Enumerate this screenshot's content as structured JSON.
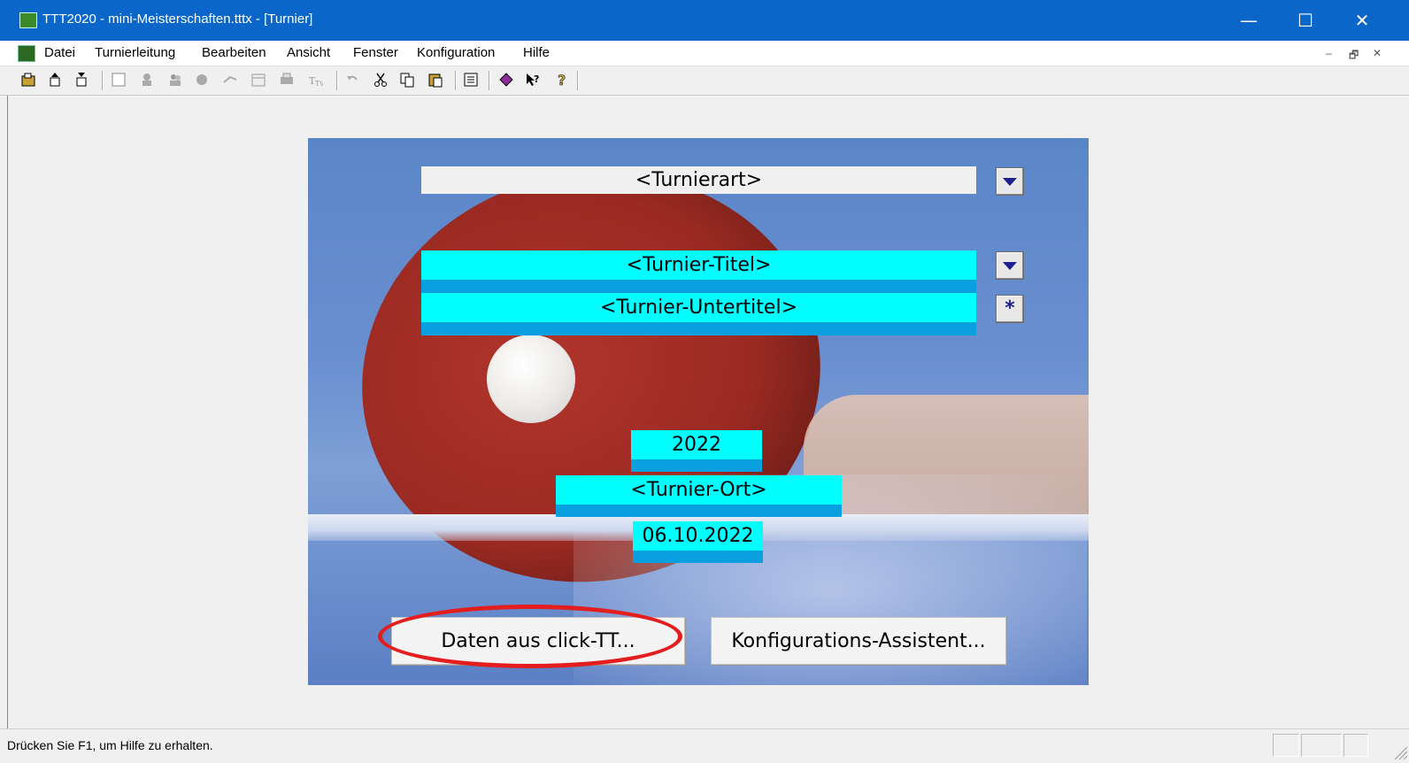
{
  "window": {
    "title": "TTT2020 - mini-Meisterschaften.tttx - [Turnier]",
    "controls": {
      "minimize": "—",
      "maximize": "☐",
      "close": "✕"
    }
  },
  "menu": {
    "items": [
      "Datei",
      "Turnierleitung",
      "Bearbeiten",
      "Ansicht",
      "Fenster",
      "Konfiguration",
      "Hilfe"
    ],
    "mdi_controls": {
      "minimize": "–",
      "restore": "🗗",
      "close": "✕"
    }
  },
  "toolbar": {
    "icons": [
      "open-icon",
      "export-icon",
      "import-icon",
      "window-icon",
      "person-icon",
      "group-icon",
      "table-icon",
      "run-icon",
      "calendar-icon",
      "print-icon",
      "tt-icon",
      "undo-icon",
      "cut-icon",
      "copy-icon",
      "paste-icon",
      "list-icon",
      "book-icon",
      "context-help-icon",
      "help-icon"
    ]
  },
  "form": {
    "turnierart": "<Turnierart>",
    "turnier_titel": "<Turnier-Titel>",
    "turnier_untertitel": "<Turnier-Untertitel>",
    "jahr": "2022",
    "turnier_ort": "<Turnier-Ort>",
    "datum": "06.10.2022",
    "star_symbol": "*"
  },
  "buttons": {
    "click_tt": "Daten aus click-TT...",
    "wizard": "Konfigurations-Assistent..."
  },
  "status": {
    "text": "Drücken Sie F1, um Hilfe zu erhalten."
  },
  "colors": {
    "titlebar": "#0a67c9",
    "field_cyan": "#00ffff",
    "field_underbar": "#0aa0e0",
    "highlight": "#e41e1e"
  }
}
